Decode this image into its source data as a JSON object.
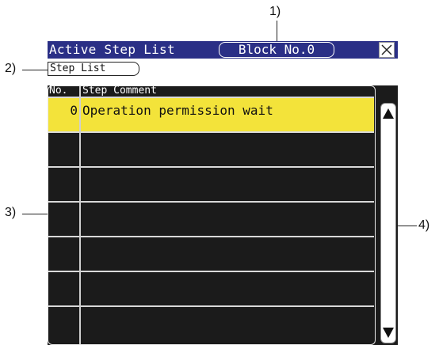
{
  "callouts": {
    "c1": "1)",
    "c2": "2)",
    "c3": "3)",
    "c4": "4)"
  },
  "window": {
    "title": "Active Step List",
    "block_label": "Block No.0",
    "close_icon": "close-icon"
  },
  "tab": {
    "label": "Step List"
  },
  "table": {
    "headers": {
      "no": "No.",
      "comment": "Step Comment"
    },
    "rows": [
      {
        "no": "0",
        "comment": "Operation permission wait",
        "selected": true
      },
      {
        "no": "",
        "comment": ""
      },
      {
        "no": "",
        "comment": ""
      },
      {
        "no": "",
        "comment": ""
      },
      {
        "no": "",
        "comment": ""
      },
      {
        "no": "",
        "comment": ""
      },
      {
        "no": "",
        "comment": ""
      }
    ]
  },
  "scrollbar": {
    "up_icon": "scroll-up-arrow-icon",
    "down_icon": "scroll-down-arrow-icon"
  },
  "colors": {
    "titlebar": "#2a2f86",
    "table_bg": "#1b1b1b",
    "selected_row": "#f3e33a"
  }
}
